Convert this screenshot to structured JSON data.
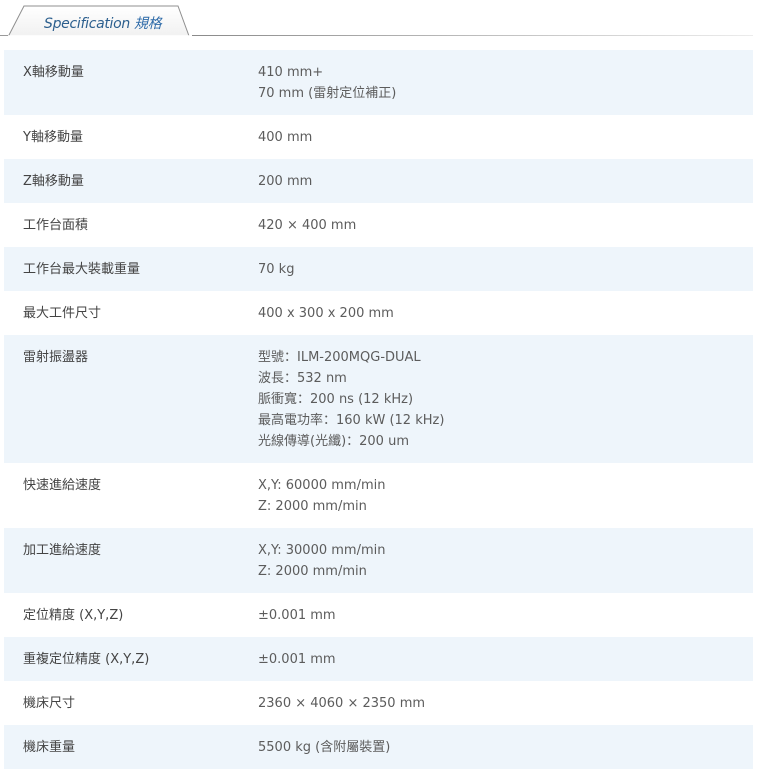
{
  "tab": {
    "label_en": "Specification",
    "label_zh": "規格"
  },
  "specs": [
    {
      "label": "X軸移動量",
      "lines": [
        "410 mm+",
        "70 mm (雷射定位補正)"
      ]
    },
    {
      "label": "Y軸移動量",
      "lines": [
        "400 mm"
      ]
    },
    {
      "label": "Z軸移動量",
      "lines": [
        "200 mm"
      ]
    },
    {
      "label": "工作台面積",
      "lines": [
        "420 × 400 mm"
      ]
    },
    {
      "label": "工作台最大裝載重量",
      "lines": [
        "70 kg"
      ]
    },
    {
      "label": "最大工件尺寸",
      "lines": [
        "400 x 300 x 200 mm"
      ]
    },
    {
      "label": "雷射振盪器",
      "lines": [
        "型號：ILM-200MQG-DUAL",
        "波長：532 nm",
        "脈衝寬：200 ns (12 kHz)",
        "最高電功率：160 kW (12 kHz)",
        "光線傳導(光纖)：200 um"
      ]
    },
    {
      "label": "快速進給速度",
      "lines": [
        "X,Y: 60000 mm/min",
        "Z: 2000 mm/min"
      ]
    },
    {
      "label": "加工進給速度",
      "lines": [
        "X,Y: 30000 mm/min",
        "Z: 2000 mm/min"
      ]
    },
    {
      "label": "定位精度 (X,Y,Z)",
      "lines": [
        "±0.001 mm"
      ]
    },
    {
      "label": "重複定位精度 (X,Y,Z)",
      "lines": [
        "±0.001 mm"
      ]
    },
    {
      "label": "機床尺寸",
      "lines": [
        "2360 × 4060 × 2350 mm"
      ]
    },
    {
      "label": "機床重量",
      "lines": [
        "5500 kg (含附屬裝置)"
      ]
    }
  ]
}
